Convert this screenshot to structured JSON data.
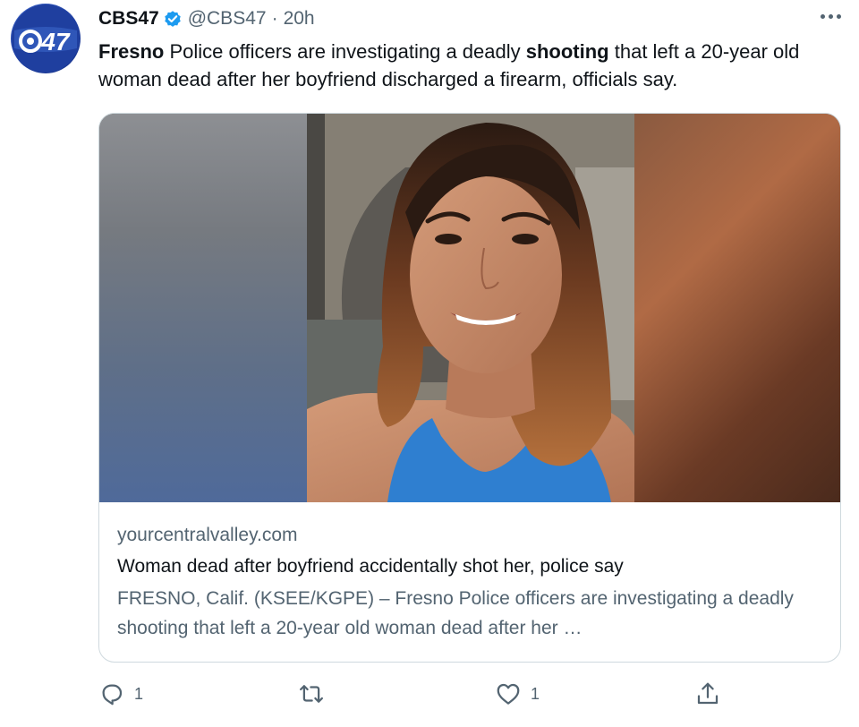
{
  "author": {
    "display_name": "CBS47",
    "handle": "@CBS47",
    "separator": "·",
    "time": "20h",
    "avatar_text": "47",
    "avatar_color": "#2143a8",
    "verified_icon": "verified-badge-icon"
  },
  "tweet": {
    "parts": [
      {
        "text": "Fresno",
        "bold": true
      },
      {
        "text": " Police officers are investigating a deadly ",
        "bold": false
      },
      {
        "text": "shooting",
        "bold": true
      },
      {
        "text": " that left a 20-year old woman dead after her boyfriend discharged a firearm, officials say.",
        "bold": false
      }
    ]
  },
  "card": {
    "domain": "yourcentralvalley.com",
    "title": "Woman dead after boyfriend accidentally shot her, police say",
    "description": "FRESNO, Calif. (KSEE/KGPE) – Fresno Police officers are investigating a deadly shooting that left a 20-year old woman dead after her …"
  },
  "actions": {
    "reply_count": "1",
    "retweet_count": "",
    "like_count": "1",
    "share_count": ""
  },
  "colors": {
    "text_primary": "#0f1419",
    "text_secondary": "#536471",
    "border": "#cfd9de",
    "verified": "#1d9bf0"
  }
}
